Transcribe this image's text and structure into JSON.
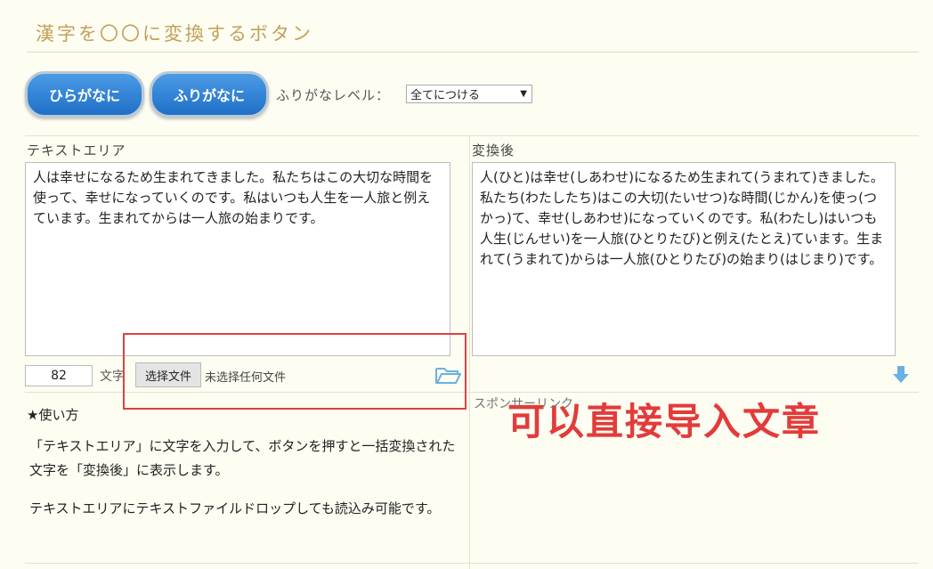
{
  "page": {
    "title": "漢字を〇〇に変換するボタン"
  },
  "toolbar": {
    "hiragana_button": "ひらがなに",
    "furigana_button": "ふりがなに",
    "level_label": "ふりがなレベル：",
    "level_selected": "全てにつける",
    "level_arrow_icon": "triangle-down-icon"
  },
  "input_panel": {
    "label": "テキストエリア",
    "text": "人は幸せになるため生まれてきました。私たちはこの大切な時間を使って、幸せになっていくのです。私はいつも人生を一人旅と例えています。生まれてからは一人旅の始まりです。",
    "char_count": "82",
    "char_unit": "文字",
    "file_button": "选择文件",
    "file_status": "未选择任何文件",
    "folder_icon": "folder-open-icon"
  },
  "output_panel": {
    "label": "変換後",
    "text": "人(ひと)は幸せ(しあわせ)になるため生まれて(うまれて)きました。私たち(わたしたち)はこの大切(たいせつ)な時間(じかん)を使っ(つかっ)て、幸せ(しあわせ)になっていくのです。私(わたし)はいつも人生(じんせい)を一人旅(ひとりたび)と例え(たとえ)ています。生まれて(うまれて)からは一人旅(ひとりたび)の始まり(はじまり)です。",
    "download_icon": "arrow-down-icon"
  },
  "howto": {
    "heading": "★使い方",
    "paragraph1": "「テキストエリア」に文字を入力して、ボタンを押すと一括変換された文字を「変換後」に表示します。",
    "paragraph2": "テキストエリアにテキストファイルドロップしても読込み可能です。"
  },
  "sponsor": {
    "label": "スポンサーリンク"
  },
  "annotation": {
    "text": "可以直接导入文章",
    "color": "#e33b3b"
  }
}
